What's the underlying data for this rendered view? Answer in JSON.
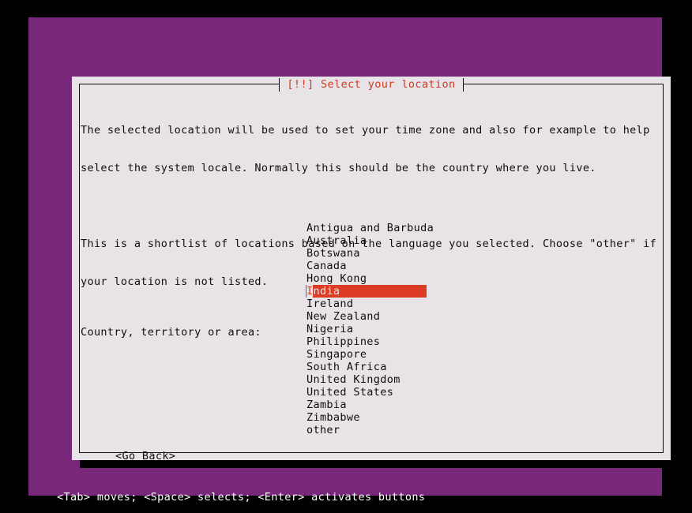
{
  "colors": {
    "terminal_background": "#77287b",
    "dialog_background": "#e7e3e6",
    "dialog_border": "#100d10",
    "title_color": "#cc3b22",
    "highlight_background": "#dc3c23",
    "highlight_text": "#e7e3e6",
    "footer_text": "#ffffff",
    "outer_background": "#000000"
  },
  "dialog": {
    "title": "[!!] Select your location",
    "paragraphs": [
      [
        "The selected location will be used to set your time zone and also for example to help",
        "select the system locale. Normally this should be the country where you live."
      ],
      [
        "This is a shortlist of locations based on the language you selected. Choose \"other\" if",
        "your location is not listed."
      ]
    ],
    "list_label": "Country, territory or area:",
    "countries": [
      "Antigua and Barbuda",
      "Australia",
      "Botswana",
      "Canada",
      "Hong Kong",
      "India",
      "Ireland",
      "New Zealand",
      "Nigeria",
      "Philippines",
      "Singapore",
      "South Africa",
      "United Kingdom",
      "United States",
      "Zambia",
      "Zimbabwe",
      "other"
    ],
    "selected_country": "India",
    "selected_index": 5,
    "cursor_char": "I",
    "go_back_label": "<Go Back>"
  },
  "footer": {
    "hint": "<Tab> moves; <Space> selects; <Enter> activates buttons"
  }
}
